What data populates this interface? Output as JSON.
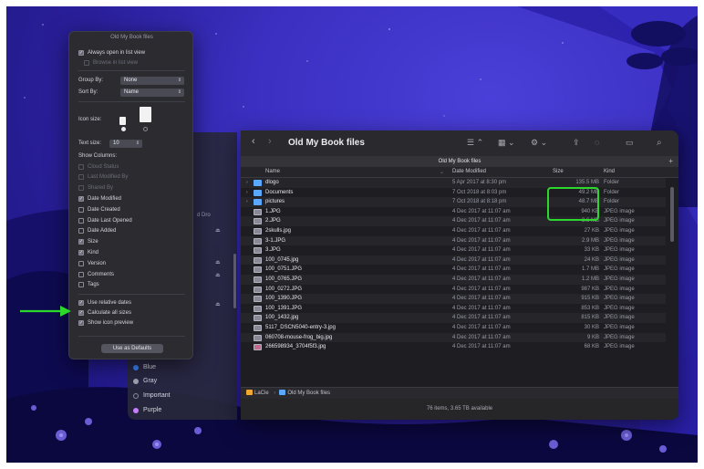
{
  "colors": {
    "desktop_bg": "#3a2fc0",
    "highlight": "#2bd82b",
    "folder_blue": "#5aa8ff"
  },
  "view_options": {
    "title": "Old My Book files",
    "always_open_list": "Always open in list view",
    "browse_list": "Browse in list view",
    "group_by_label": "Group By:",
    "group_by_value": "None",
    "sort_by_label": "Sort By:",
    "sort_by_value": "Name",
    "icon_size_label": "Icon size:",
    "text_size_label": "Text size:",
    "text_size_value": "10",
    "show_columns_label": "Show Columns:",
    "columns": [
      {
        "label": "Cloud Status",
        "checked": false,
        "dim": true
      },
      {
        "label": "Last Modified By",
        "checked": false,
        "dim": true
      },
      {
        "label": "Shared By",
        "checked": false,
        "dim": true
      },
      {
        "label": "Date Modified",
        "checked": true,
        "dim": false
      },
      {
        "label": "Date Created",
        "checked": false,
        "dim": false
      },
      {
        "label": "Date Last Opened",
        "checked": false,
        "dim": false
      },
      {
        "label": "Date Added",
        "checked": false,
        "dim": false
      },
      {
        "label": "Size",
        "checked": true,
        "dim": false
      },
      {
        "label": "Kind",
        "checked": true,
        "dim": false
      },
      {
        "label": "Version",
        "checked": false,
        "dim": false
      },
      {
        "label": "Comments",
        "checked": false,
        "dim": false
      },
      {
        "label": "Tags",
        "checked": false,
        "dim": false
      }
    ],
    "use_relative_dates": "Use relative dates",
    "calculate_all_sizes": "Calculate all sizes",
    "show_icon_preview": "Show icon preview",
    "use_as_defaults": "Use as Defaults"
  },
  "sidebar": {
    "fragment_drop": "d Dro",
    "tags": [
      {
        "label": "Blue",
        "color": "#3b82f6"
      },
      {
        "label": "Gray",
        "color": "#9ca3af"
      },
      {
        "label": "Important",
        "color": "#4a4a54"
      },
      {
        "label": "Purple",
        "color": "#c77dff"
      }
    ]
  },
  "finder": {
    "title": "Old My Book files",
    "path_title": "Old My Book files",
    "nav_back": "‹",
    "nav_forward": "›",
    "toolbar_icons": [
      "view-list-icon",
      "group-icon",
      "action-icon",
      "share-icon",
      "tag-icon",
      "trash-icon",
      "search-icon"
    ],
    "columns": {
      "name": "Name",
      "date": "Date Modified",
      "size": "Size",
      "kind": "Kind"
    },
    "rows": [
      {
        "disc": "›",
        "type": "folder",
        "name": "dlogo",
        "date": "5 Apr 2017 at 8:30 pm",
        "size": "135.5 MB",
        "kind": "Folder"
      },
      {
        "disc": "›",
        "type": "folder",
        "name": "Documents",
        "date": "7 Oct 2018 at 8:03 pm",
        "size": "49.2 MB",
        "kind": "Folder"
      },
      {
        "disc": "›",
        "type": "folder",
        "name": "pictures",
        "date": "7 Oct 2018 at 8:18 pm",
        "size": "48.7 MB",
        "kind": "Folder"
      },
      {
        "disc": "",
        "type": "jpeg",
        "name": "1.JPG",
        "date": "4 Dec 2017 at 11:07 am",
        "size": "940 KB",
        "kind": "JPEG image"
      },
      {
        "disc": "",
        "type": "jpeg",
        "name": "2.JPG",
        "date": "4 Dec 2017 at 11:07 am",
        "size": "3.6 MB",
        "kind": "JPEG image"
      },
      {
        "disc": "",
        "type": "jpeg",
        "name": "2skulls.jpg",
        "date": "4 Dec 2017 at 11:07 am",
        "size": "27 KB",
        "kind": "JPEG image"
      },
      {
        "disc": "",
        "type": "jpeg",
        "name": "3-1.JPG",
        "date": "4 Dec 2017 at 11:07 am",
        "size": "2.9 MB",
        "kind": "JPEG image"
      },
      {
        "disc": "",
        "type": "jpeg",
        "name": "3.JPG",
        "date": "4 Dec 2017 at 11:07 am",
        "size": "33 KB",
        "kind": "JPEG image"
      },
      {
        "disc": "",
        "type": "jpeg",
        "name": "100_0745.jpg",
        "date": "4 Dec 2017 at 11:07 am",
        "size": "24 KB",
        "kind": "JPEG image"
      },
      {
        "disc": "",
        "type": "jpeg",
        "name": "100_0751.JPG",
        "date": "4 Dec 2017 at 11:07 am",
        "size": "1.7 MB",
        "kind": "JPEG image"
      },
      {
        "disc": "",
        "type": "jpeg",
        "name": "100_0765.JPG",
        "date": "4 Dec 2017 at 11:07 am",
        "size": "1.2 MB",
        "kind": "JPEG image"
      },
      {
        "disc": "",
        "type": "jpeg",
        "name": "100_0272.JPG",
        "date": "4 Dec 2017 at 11:07 am",
        "size": "987 KB",
        "kind": "JPEG image"
      },
      {
        "disc": "",
        "type": "jpeg",
        "name": "100_1390.JPG",
        "date": "4 Dec 2017 at 11:07 am",
        "size": "915 KB",
        "kind": "JPEG image"
      },
      {
        "disc": "",
        "type": "jpeg",
        "name": "100_1391.JPG",
        "date": "4 Dec 2017 at 11:07 am",
        "size": "853 KB",
        "kind": "JPEG image"
      },
      {
        "disc": "",
        "type": "jpeg",
        "name": "100_1432.jpg",
        "date": "4 Dec 2017 at 11:07 am",
        "size": "815 KB",
        "kind": "JPEG image"
      },
      {
        "disc": "",
        "type": "jpeg",
        "name": "5117_DSCN5040-entry-3.jpg",
        "date": "4 Dec 2017 at 11:07 am",
        "size": "30 KB",
        "kind": "JPEG image"
      },
      {
        "disc": "",
        "type": "jpeg",
        "name": "060708-mouse-frog_big.jpg",
        "date": "4 Dec 2017 at 11:07 am",
        "size": "9 KB",
        "kind": "JPEG image"
      },
      {
        "disc": "",
        "type": "jpeg-pink",
        "name": "266598934_3704f5f3.jpg",
        "date": "4 Dec 2017 at 11:07 am",
        "size": "68 KB",
        "kind": "JPEG image"
      }
    ],
    "pathbar": {
      "root": "LaCie",
      "separator": "›",
      "folder": "Old My Book files"
    },
    "status": "76 items, 3.65 TB available"
  }
}
